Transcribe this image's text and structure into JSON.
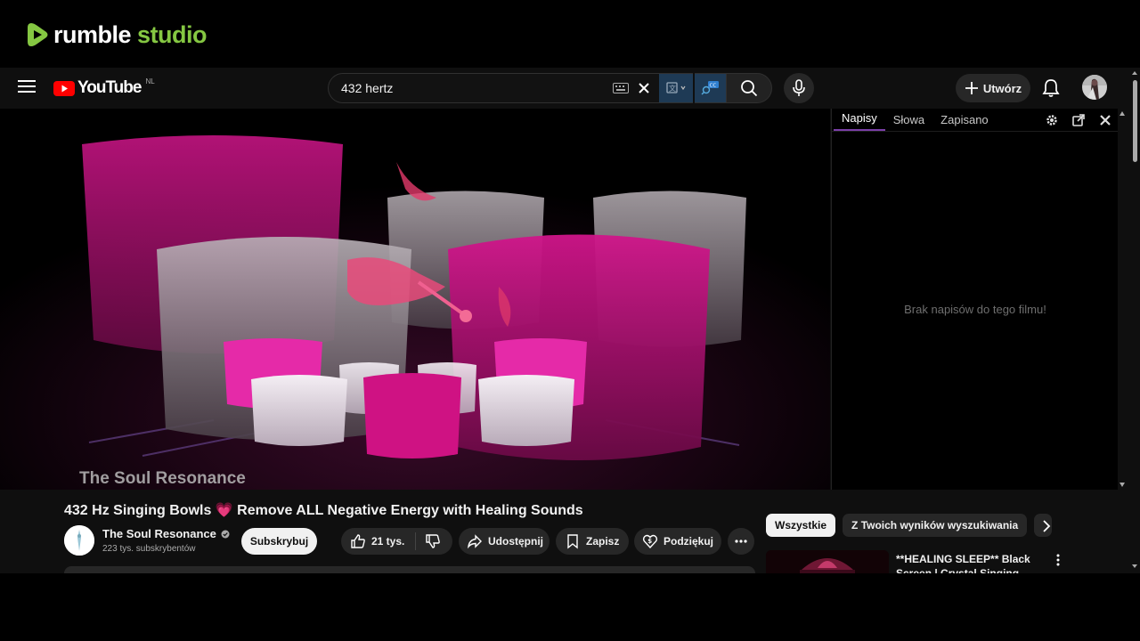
{
  "rumble": {
    "word": "rumble",
    "suffix": "studio",
    "accent": "#85c742"
  },
  "youtube": {
    "brand": "YouTube",
    "country_code": "NL",
    "search": {
      "value": "432 hertz"
    },
    "create_label": "Utwórz"
  },
  "player": {
    "watermark": "The Soul Resonance"
  },
  "transcript": {
    "tabs": [
      "Napisy",
      "Słowa",
      "Zapisano"
    ],
    "active_tab": "Napisy",
    "empty_message": "Brak napisów do tego filmu!",
    "accent": "#7b3fa8"
  },
  "video": {
    "title": "432 Hz Singing Bowls 💗 Remove ALL Negative Energy with Healing Sounds",
    "channel_name": "The Soul Resonance",
    "subscribers": "223 tys. subskrybentów",
    "subscribe_label": "Subskrybuj",
    "likes": "21 tys.",
    "share_label": "Udostępnij",
    "save_label": "Zapisz",
    "thanks_label": "Podziękuj"
  },
  "chips": [
    "Wszystkie",
    "Z Twoich wyników wyszukiwania"
  ],
  "recommendation": {
    "title": "**HEALING SLEEP** Black Screen | Crystal Singing Bowls"
  }
}
